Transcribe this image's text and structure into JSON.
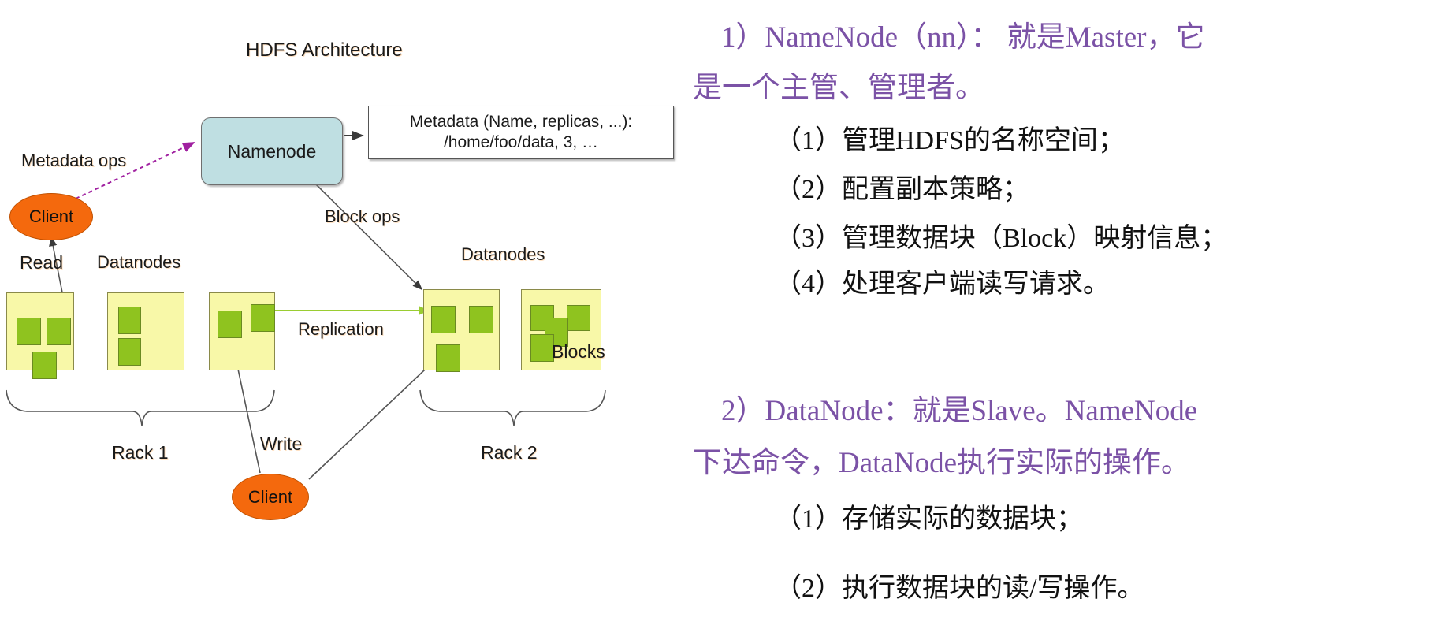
{
  "diagram": {
    "title": "HDFS Architecture",
    "nodes": {
      "namenode": "Namenode",
      "client_top": "Client",
      "client_bottom": "Client"
    },
    "metadata_box": {
      "line1": "Metadata (Name, replicas, ...):",
      "line2": "/home/foo/data, 3, …"
    },
    "edges": {
      "metadata_ops": "Metadata ops",
      "block_ops": "Block ops",
      "read": "Read",
      "write": "Write",
      "replication": "Replication"
    },
    "labels": {
      "datanodes_left": "Datanodes",
      "datanodes_right": "Datanodes",
      "blocks": "Blocks",
      "rack1": "Rack 1",
      "rack2": "Rack 2"
    },
    "colors": {
      "namenode_fill": "#bfdfe2",
      "client_fill": "#f4690d",
      "rack_node_fill": "#f8f8a8",
      "block_fill": "#8fc31f",
      "replication_arrow": "#9acd32",
      "metadata_ops_arrow": "#a020a0"
    }
  },
  "notes": {
    "lines": [
      {
        "text": "1）NameNode（nn）： 就是Master，它",
        "level": "main"
      },
      {
        "text": "是一个主管、管理者。",
        "level": "main"
      },
      {
        "text": "（1）管理HDFS的名称空间；",
        "level": "sub"
      },
      {
        "text": "（2）配置副本策略；",
        "level": "sub"
      },
      {
        "text": "（3）管理数据块（Block）映射信息；",
        "level": "sub"
      },
      {
        "text": "（4）处理客户端读写请求。",
        "level": "sub"
      },
      {
        "text": "2）DataNode：就是Slave。NameNode",
        "level": "main"
      },
      {
        "text": "下达命令，DataNode执行实际的操作。",
        "level": "main"
      },
      {
        "text": "（1）存储实际的数据块；",
        "level": "sub"
      },
      {
        "text": "（2）执行数据块的读/写操作。",
        "level": "sub"
      }
    ],
    "colors": {
      "main": "#7b52a6",
      "sub": "#111111"
    }
  }
}
